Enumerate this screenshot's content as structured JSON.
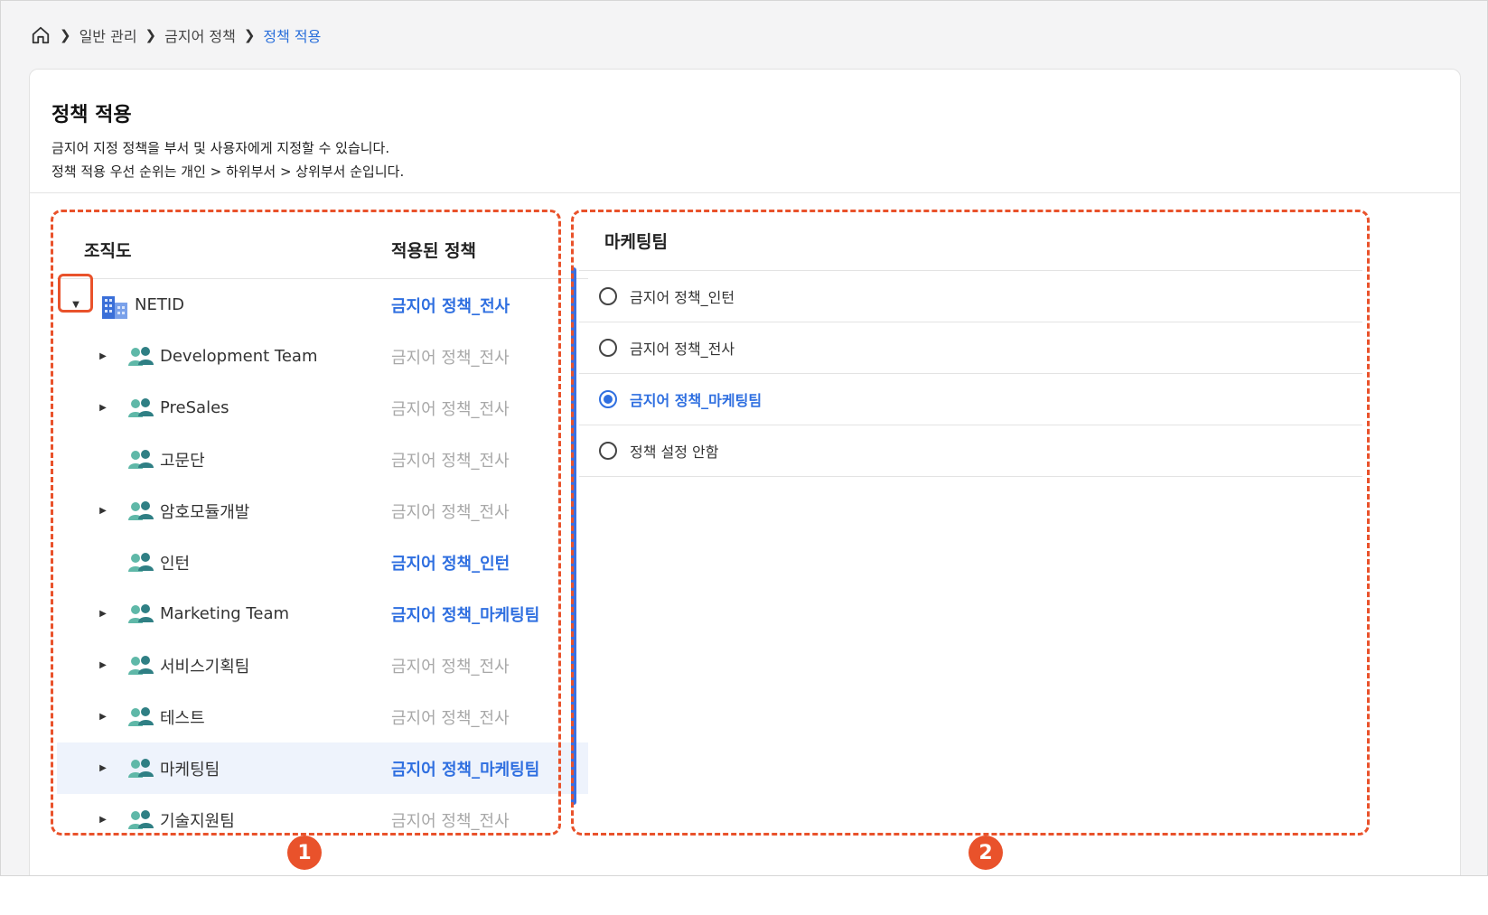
{
  "breadcrumb": {
    "items": [
      "일반 관리",
      "금지어 정책",
      "정책 적용"
    ]
  },
  "page": {
    "title": "정책 적용",
    "desc_line1": "금지어 지정 정책을 부서 및 사용자에게 지정할 수 있습니다.",
    "desc_line2": "정책 적용 우선 순위는 개인 > 하위부서 > 상위부서 순입니다."
  },
  "tree": {
    "header_org": "조직도",
    "header_policy": "적용된 정책",
    "rows": [
      {
        "label": "NETID",
        "policy": "금지어 정책_전사",
        "applied": true,
        "level": 0,
        "expanded": true,
        "icon": "building-icon"
      },
      {
        "label": "Development Team",
        "policy": "금지어 정책_전사",
        "applied": false,
        "level": 1,
        "has_children": true,
        "icon": "group-icon"
      },
      {
        "label": "PreSales",
        "policy": "금지어 정책_전사",
        "applied": false,
        "level": 1,
        "has_children": true,
        "icon": "group-icon"
      },
      {
        "label": "고문단",
        "policy": "금지어 정책_전사",
        "applied": false,
        "level": 1,
        "has_children": false,
        "icon": "group-icon"
      },
      {
        "label": "암호모듈개발",
        "policy": "금지어 정책_전사",
        "applied": false,
        "level": 1,
        "has_children": true,
        "icon": "group-icon"
      },
      {
        "label": "인턴",
        "policy": "금지어 정책_인턴",
        "applied": true,
        "level": 1,
        "has_children": false,
        "icon": "group-icon"
      },
      {
        "label": "Marketing Team",
        "policy": "금지어 정책_마케팅팀",
        "applied": true,
        "level": 1,
        "has_children": true,
        "icon": "group-icon"
      },
      {
        "label": "서비스기획팀",
        "policy": "금지어 정책_전사",
        "applied": false,
        "level": 1,
        "has_children": true,
        "icon": "group-icon"
      },
      {
        "label": "테스트",
        "policy": "금지어 정책_전사",
        "applied": false,
        "level": 1,
        "has_children": true,
        "icon": "group-icon"
      },
      {
        "label": "마케팅팀",
        "policy": "금지어 정책_마케팅팀",
        "applied": true,
        "level": 1,
        "has_children": true,
        "selected": true,
        "icon": "group-icon"
      },
      {
        "label": "기술지원팀",
        "policy": "금지어 정책_전사",
        "applied": false,
        "level": 1,
        "has_children": true,
        "icon": "group-icon"
      }
    ]
  },
  "policy_panel": {
    "title": "마케팅팀",
    "options": [
      {
        "label": "금지어 정책_인턴",
        "checked": false
      },
      {
        "label": "금지어 정책_전사",
        "checked": false
      },
      {
        "label": "금지어 정책_마케팅팀",
        "checked": true
      },
      {
        "label": "정책 설정 안함",
        "checked": false
      }
    ]
  },
  "annotations": {
    "badge1": "1",
    "badge2": "2",
    "color": "#e9522b"
  },
  "colors": {
    "accent": "#2f6fe0",
    "muted": "#a8a8a8",
    "selected_row": "#eef3fc"
  }
}
